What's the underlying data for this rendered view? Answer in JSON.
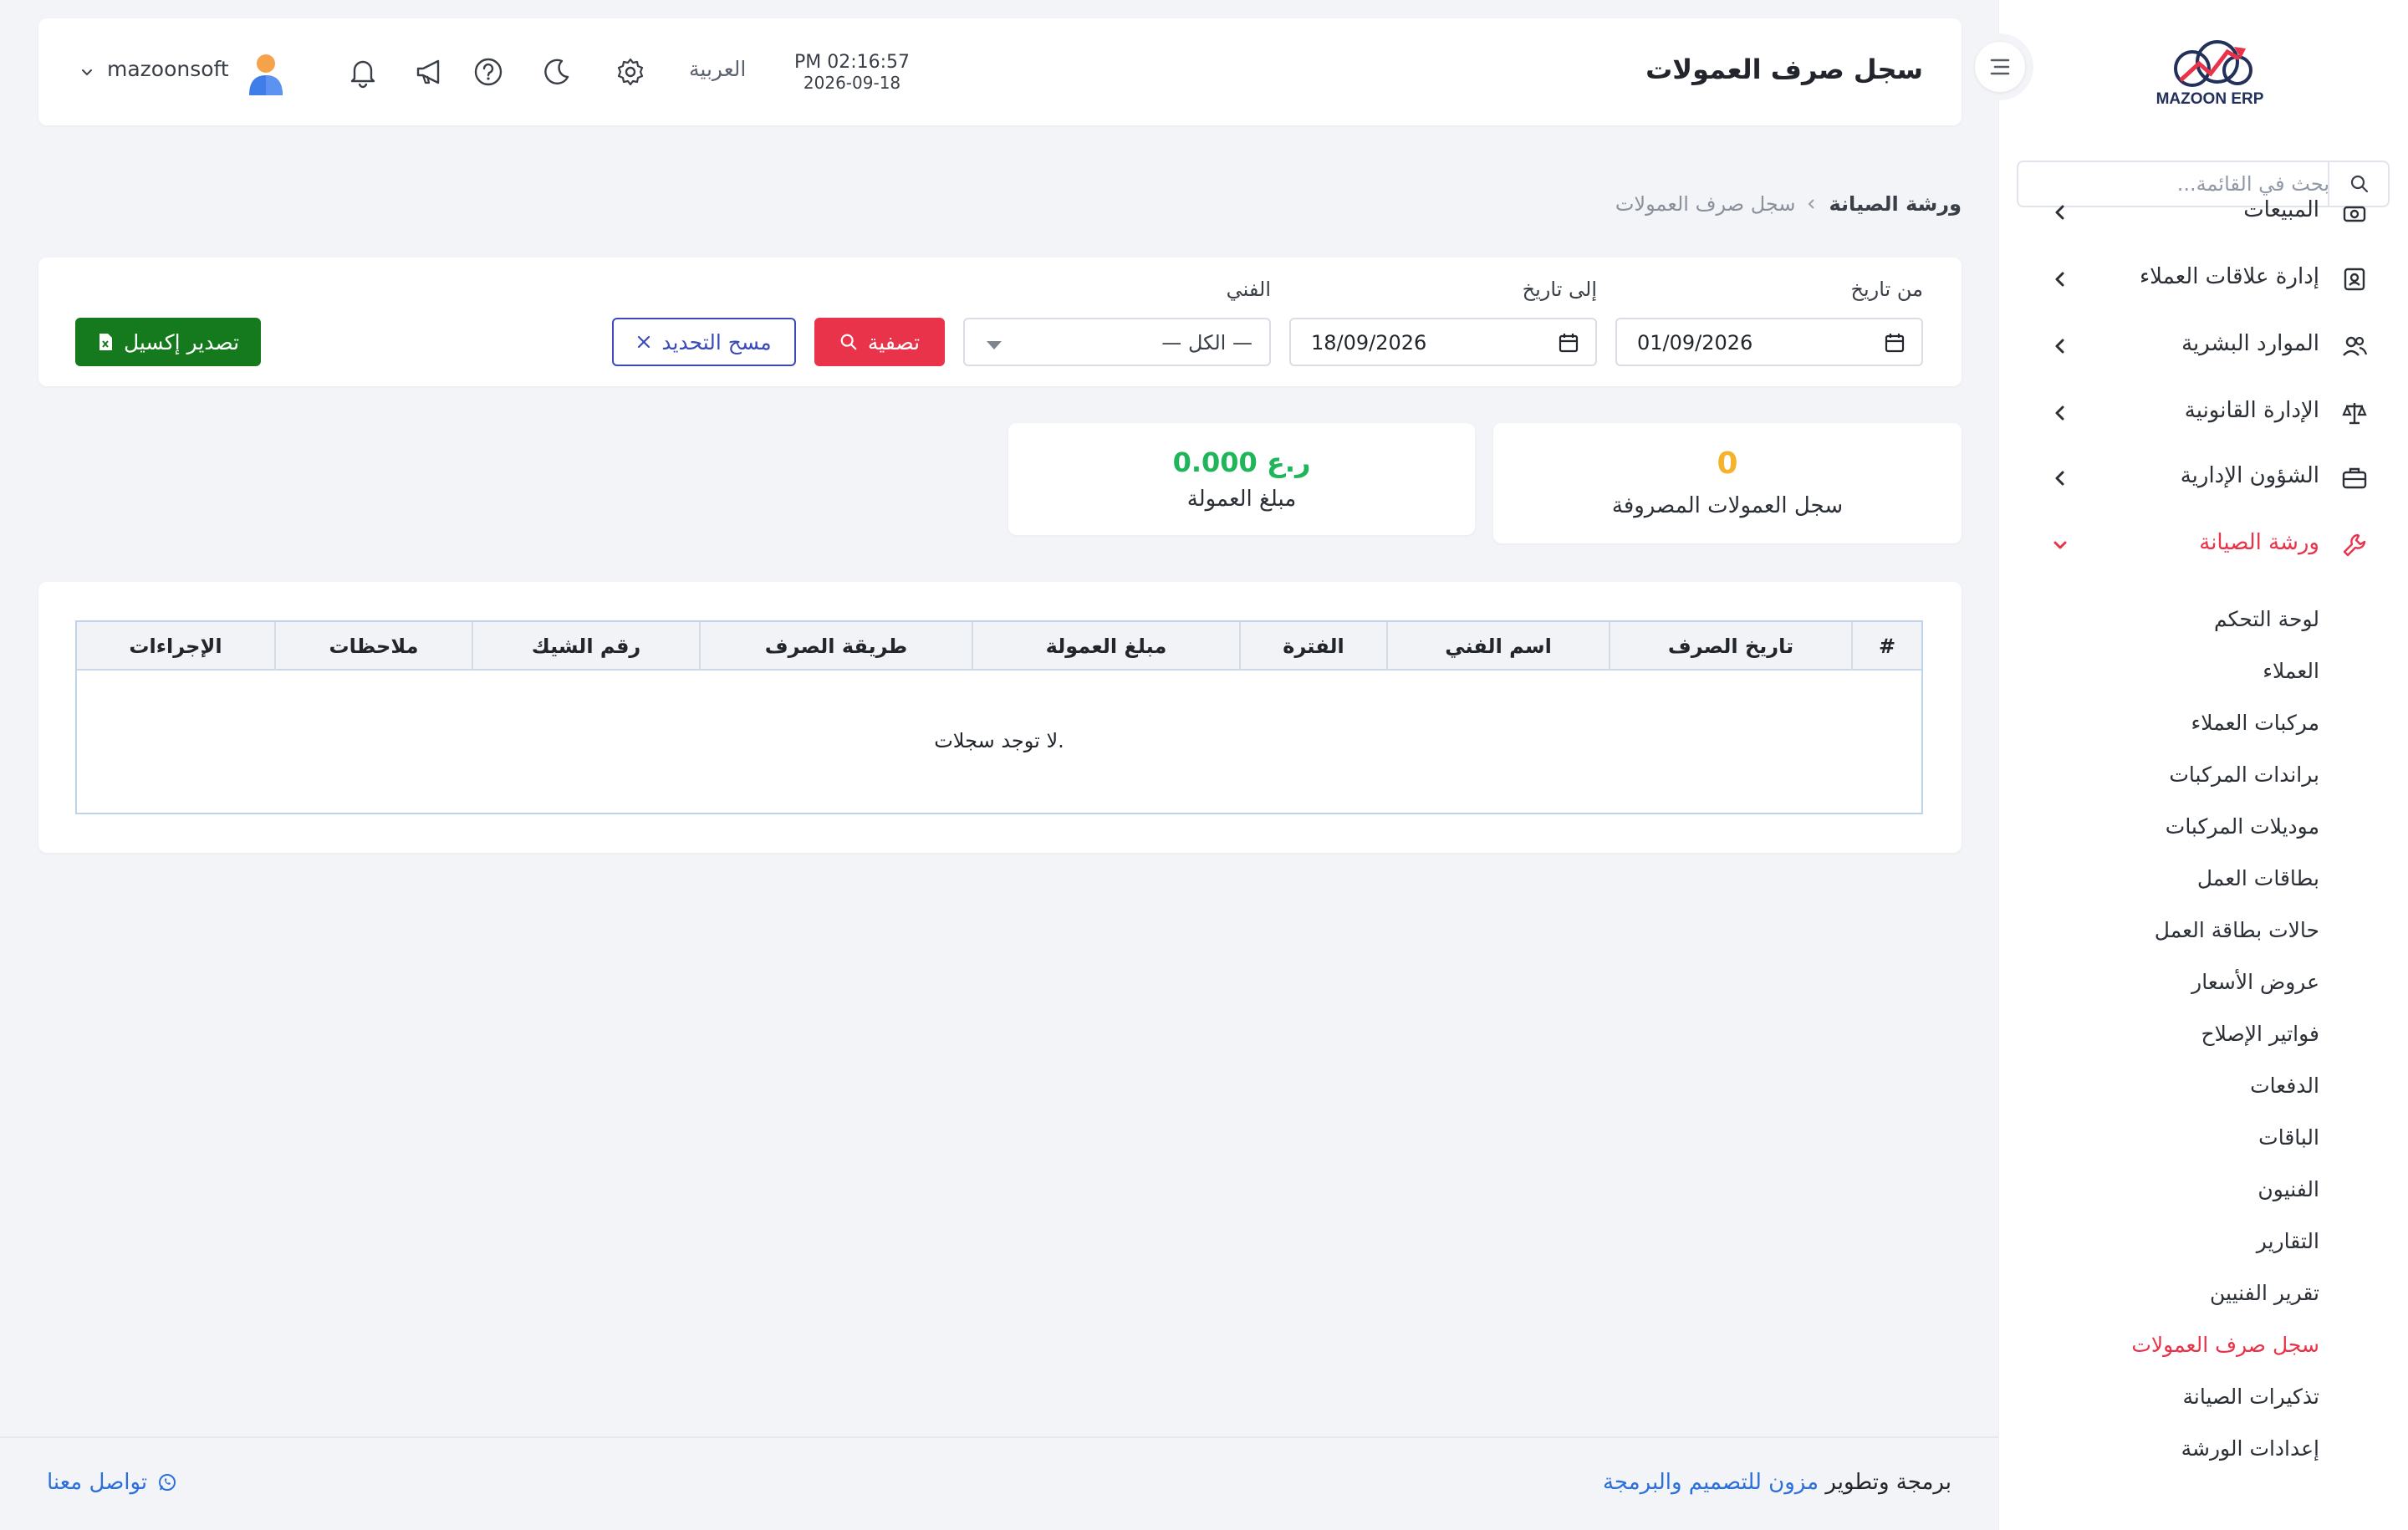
{
  "sidebar": {
    "logo_text": "MAZOON ERP",
    "search_placeholder": "بحث في القائمة...",
    "items": [
      {
        "label": "المبيعات",
        "icon": "cash-register-icon"
      },
      {
        "label": "إدارة علاقات العملاء",
        "icon": "contact-card-icon"
      },
      {
        "label": "الموارد البشرية",
        "icon": "users-icon"
      },
      {
        "label": "الإدارة القانونية",
        "icon": "scale-icon"
      },
      {
        "label": "الشؤون الإدارية",
        "icon": "briefcase-icon"
      },
      {
        "label": "ورشة الصيانة",
        "icon": "wrench-icon",
        "active": true
      }
    ],
    "submenu": [
      "لوحة التحكم",
      "العملاء",
      "مركبات العملاء",
      "براندات المركبات",
      "موديلات المركبات",
      "بطاقات العمل",
      "حالات بطاقة العمل",
      "عروض الأسعار",
      "فواتير الإصلاح",
      "الدفعات",
      "الباقات",
      "الفنيون",
      "التقارير",
      "تقرير الفنيين",
      "سجل صرف العمولات",
      "تذكيرات الصيانة",
      "إعدادات الورشة"
    ],
    "active_submenu": "سجل صرف العمولات"
  },
  "header": {
    "title": "سجل صرف العمولات",
    "time": "PM 02:16:57",
    "date": "2026-09-18",
    "language": "العربية",
    "username": "mazoonsoft"
  },
  "breadcrumb": {
    "parent": "ورشة الصيانة",
    "current": "سجل صرف العمولات"
  },
  "filters": {
    "from_label": "من تاريخ",
    "from_value": "01/09/2026",
    "to_label": "إلى تاريخ",
    "to_value": "18/09/2026",
    "tech_label": "الفني",
    "tech_value": "— الكل —",
    "filter_button": "تصفية",
    "reset_button": "مسح التحديد",
    "export_button": "تصدير إكسيل"
  },
  "stats": [
    {
      "value": "0",
      "label": "سجل العمولات المصروفة",
      "color": "#f4b22d"
    },
    {
      "value": "0.000 ر.ع",
      "label": "مبلغ العمولة",
      "color": "#1fb65a"
    }
  ],
  "table": {
    "columns": [
      "#",
      "تاريخ الصرف",
      "اسم الفني",
      "الفترة",
      "مبلغ العمولة",
      "طريقة الصرف",
      "رقم الشيك",
      "ملاحظات",
      "الإجراءات"
    ],
    "rows": [],
    "empty_message": "لا توجد سجلات."
  },
  "footer": {
    "credit_prefix": "برمجة وتطوير",
    "credit_link": "مزون للتصميم والبرمجة",
    "contact": "تواصل معنا"
  },
  "colors": {
    "accent_red": "#e8334a",
    "excel_green": "#157a1e",
    "reset_blue": "#3a4bb8",
    "link_blue": "#2a6fdb"
  }
}
